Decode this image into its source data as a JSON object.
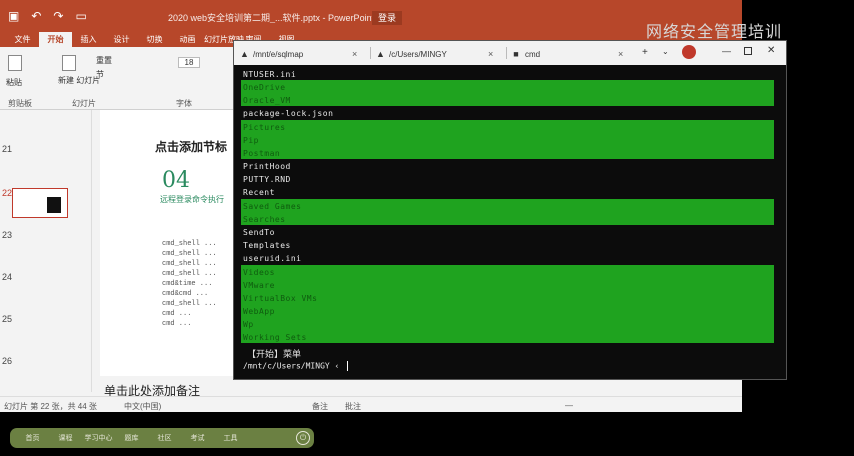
{
  "ppt": {
    "doc_title": "2020 web安全培训第二期_...软件.pptx - PowerPoint",
    "login_label": "登录",
    "qat": [
      "save-icon",
      "undo-icon",
      "redo-icon",
      "start-slideshow-icon"
    ],
    "menu": [
      "文件",
      "开始",
      "插入",
      "设计",
      "切换",
      "动画",
      "幻灯片放映",
      "审阅",
      "视图"
    ],
    "active_menu": "开始",
    "ribbon": {
      "paste": "粘贴",
      "new_slide": "新建\n幻灯片",
      "reset": "重置",
      "section": "节",
      "font_size": "18",
      "clipboard": "剪贴板",
      "slides": "幻灯片",
      "font": "字体"
    },
    "slide_numbers": [
      "21",
      "22",
      "23",
      "24",
      "25",
      "26"
    ],
    "selected_slide": "22",
    "slide": {
      "heading": "点击添加节标",
      "number": "04",
      "subtitle": "远程登录命令执行",
      "code_lines": [
        "cmd_shell ...",
        "cmd_shell ...",
        "cmd_shell ...",
        "cmd_shell ...",
        "cmd&time ...",
        "cmd&cmd ...",
        "cmd_shell ...",
        "cmd ...",
        "cmd ..."
      ]
    },
    "notes": "单击此处添加备注",
    "status": {
      "slide_info": "幻灯片 第 22 张，共 44 张",
      "language": "中文(中国)",
      "notes_btn": "备注",
      "comments_btn": "批注",
      "zoom": "—"
    }
  },
  "watermark": "网络安全管理培训",
  "terminal": {
    "tabs": [
      {
        "icon": "linux-penguin-icon",
        "label": "/mnt/e/sqlmap"
      },
      {
        "icon": "linux-penguin-icon",
        "label": "/c/Users/MINGY"
      },
      {
        "icon": "cmd-icon",
        "label": "cmd"
      }
    ],
    "new_tab": "+",
    "lines": [
      "NTUSER.ini",
      "OneDrive",
      "Oracle_VM",
      "package-lock.json",
      "Pictures",
      "Pip",
      "Postman",
      "PrintHood",
      "PUTTY.RND",
      "Recent",
      "Saved Games",
      "Searches",
      "SendTo",
      "Templates",
      "useruid.ini",
      "Videos",
      "VMware",
      "VirtualBox VMs",
      "WebApp",
      "Wp",
      "Working Sets"
    ],
    "menu_prompt": "【开始】菜单",
    "prompt": "/mnt/c/Users/MINGY ‹"
  },
  "dock": {
    "items": [
      "首页",
      "课程",
      "学习中心",
      "题库",
      "社区",
      "考试",
      "工具"
    ],
    "power_icon": "power-icon"
  },
  "colors": {
    "ppt_red": "#b7472a",
    "highlight_green": "#1fa31f",
    "terminal_bg": "#0c0c0c",
    "dock_green": "#6b8042"
  }
}
